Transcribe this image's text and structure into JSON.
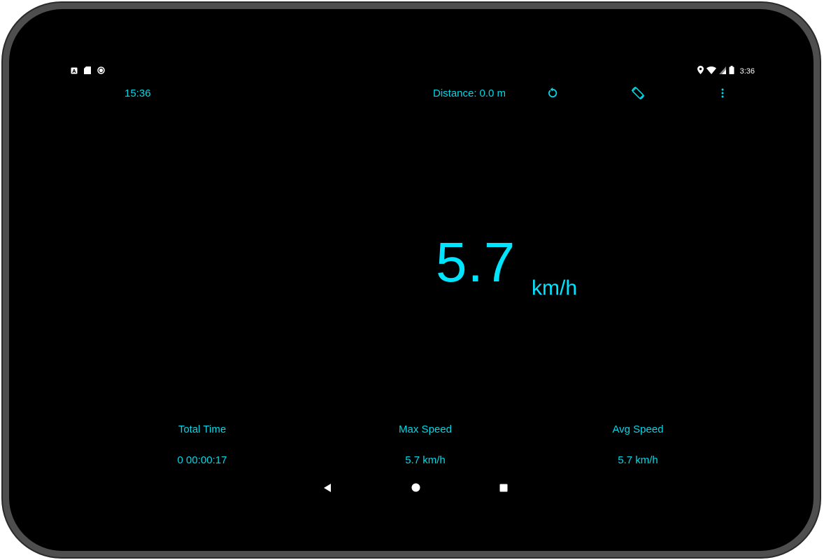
{
  "status_bar": {
    "left_icons": [
      "a-notification-icon",
      "sd-card-icon",
      "circle-notification-icon"
    ],
    "right_icons": [
      "location-icon",
      "wifi-icon",
      "signal-icon",
      "battery-icon"
    ],
    "time": "3:36"
  },
  "app_bar": {
    "clock": "15:36",
    "distance_label": "Distance:",
    "distance_value": "0.0 m",
    "actions": [
      "reset-icon",
      "screen-rotation-icon",
      "more-vert-icon"
    ]
  },
  "speed": {
    "value": "5.7",
    "unit": "km/h"
  },
  "stats": {
    "total_time_label": "Total Time",
    "total_time_value": "0 00:00:17",
    "max_speed_label": "Max Speed",
    "max_speed_value": "5.7 km/h",
    "avg_speed_label": "Avg Speed",
    "avg_speed_value": "5.7 km/h"
  },
  "nav_bar": {
    "buttons": [
      "back-icon",
      "home-icon",
      "recents-icon"
    ]
  },
  "colors": {
    "accent": "#00e5ff",
    "accent_text": "#00d8e8",
    "background": "#000000",
    "frame": "#4e4e4e"
  }
}
